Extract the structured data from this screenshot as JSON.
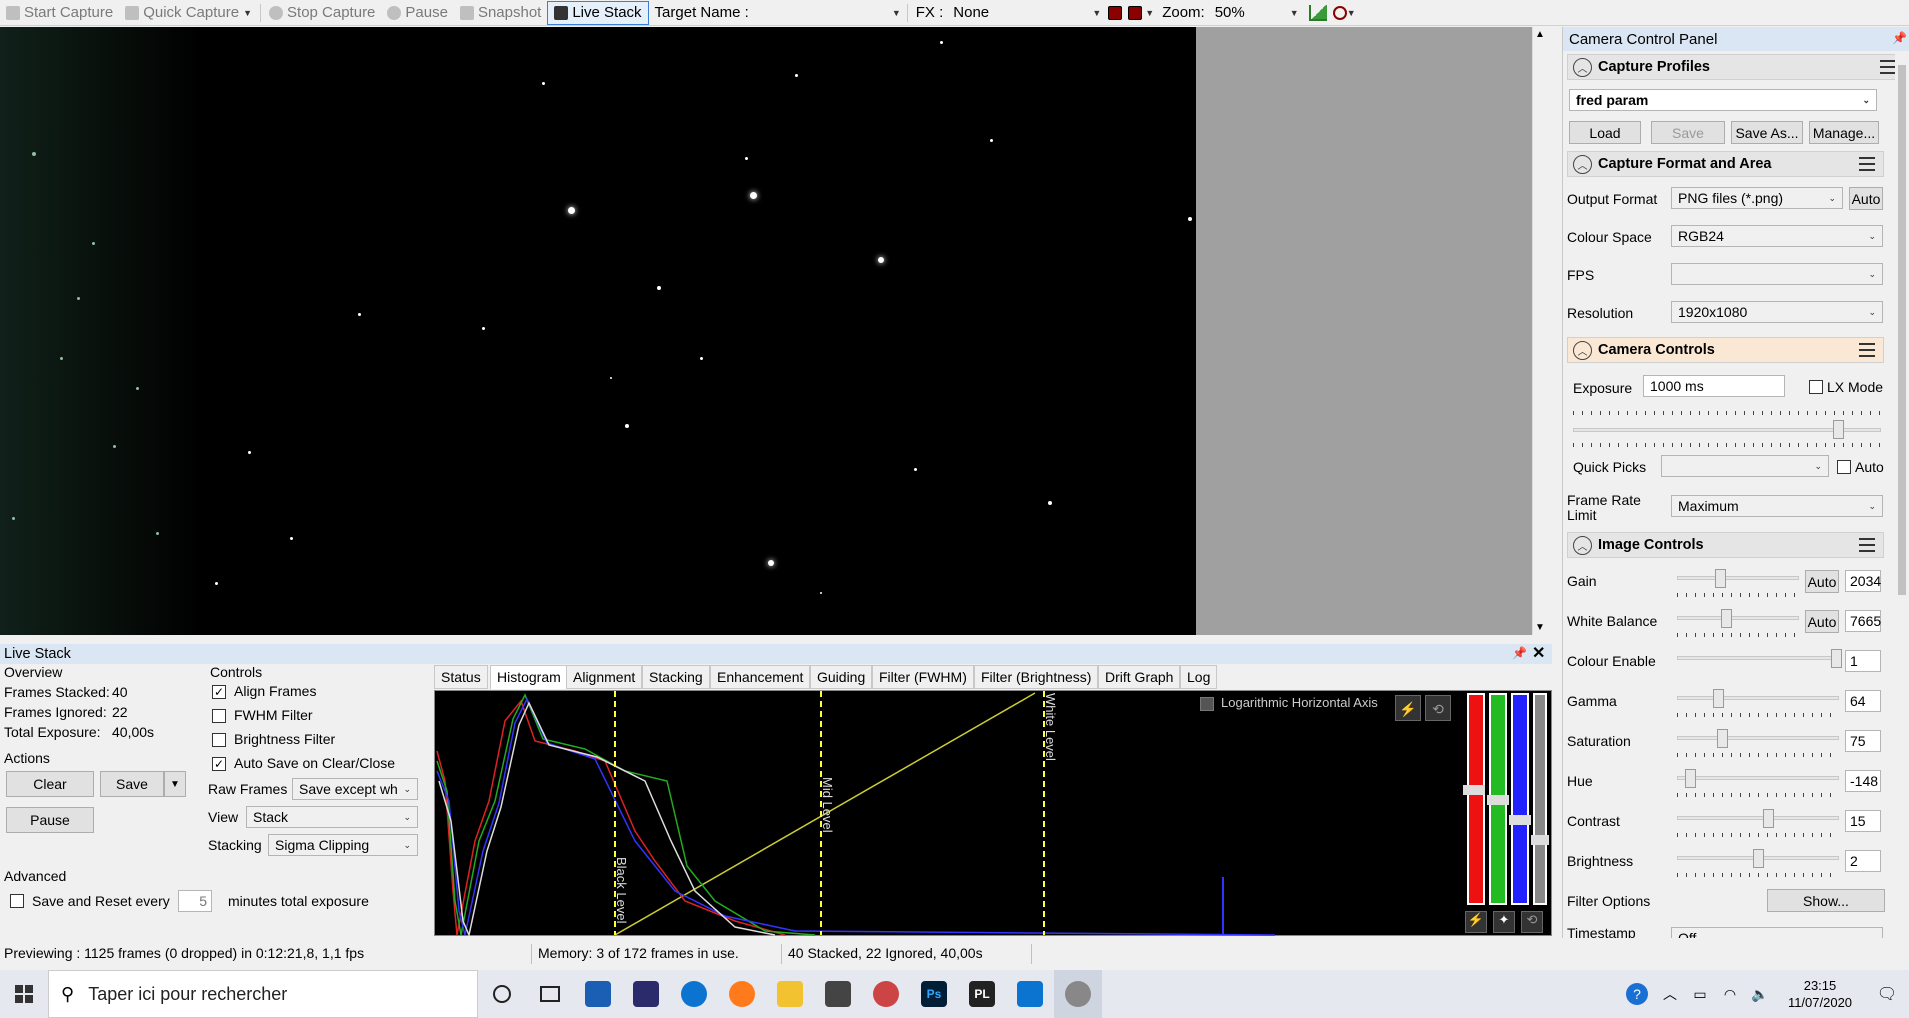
{
  "toolbar": {
    "start_capture": "Start Capture",
    "quick_capture": "Quick Capture",
    "stop_capture": "Stop Capture",
    "pause": "Pause",
    "snapshot": "Snapshot",
    "live_stack": "Live Stack",
    "target_name_label": "Target Name :",
    "target_name_value": "",
    "fx_label": "FX :",
    "fx_value": "None",
    "zoom_label": "Zoom:",
    "zoom_value": "50%"
  },
  "panel": {
    "title": "Camera Control Panel",
    "capture_profiles": {
      "heading": "Capture Profiles",
      "profile": "fred param",
      "load": "Load",
      "save": "Save",
      "save_as": "Save As...",
      "manage": "Manage..."
    },
    "capture_format": {
      "heading": "Capture Format and Area",
      "output_format_label": "Output Format",
      "output_format": "PNG files (*.png)",
      "auto": "Auto",
      "colour_space_label": "Colour Space",
      "colour_space": "RGB24",
      "fps_label": "FPS",
      "fps": "",
      "resolution_label": "Resolution",
      "resolution": "1920x1080"
    },
    "camera_controls": {
      "heading": "Camera Controls",
      "exposure_label": "Exposure",
      "exposure": "1000 ms",
      "lx_mode": "LX Mode",
      "quick_picks_label": "Quick Picks",
      "quick_picks": "",
      "auto": "Auto",
      "frame_rate_label": "Frame Rate Limit",
      "frame_rate": "Maximum"
    },
    "image_controls": {
      "heading": "Image Controls",
      "rows": [
        {
          "label": "Gain",
          "auto": "Auto",
          "value": "2034"
        },
        {
          "label": "White Balance",
          "auto": "Auto",
          "value": "7665"
        },
        {
          "label": "Colour Enable",
          "value": "1"
        },
        {
          "label": "Gamma",
          "value": "64"
        },
        {
          "label": "Saturation",
          "value": "75"
        },
        {
          "label": "Hue",
          "value": "-148"
        },
        {
          "label": "Contrast",
          "value": "15"
        },
        {
          "label": "Brightness",
          "value": "2"
        }
      ],
      "filter_options_label": "Filter Options",
      "show": "Show...",
      "timestamp_label": "Timestamp",
      "timestamp": "Off"
    }
  },
  "livestack": {
    "title": "Live Stack",
    "overview": "Overview",
    "frames_stacked_label": "Frames Stacked:",
    "frames_stacked": "40",
    "frames_ignored_label": "Frames Ignored:",
    "frames_ignored": "22",
    "total_exposure_label": "Total Exposure:",
    "total_exposure": "40,00s",
    "actions": "Actions",
    "clear": "Clear",
    "save": "Save",
    "pause": "Pause",
    "advanced": "Advanced",
    "save_reset_label": "Save and Reset every",
    "save_reset_value": "5",
    "save_reset_suffix": "minutes total exposure",
    "controls": "Controls",
    "align_frames": "Align Frames",
    "fwhm_filter": "FWHM Filter",
    "brightness_filter": "Brightness Filter",
    "auto_save": "Auto Save on Clear/Close",
    "raw_frames_label": "Raw Frames",
    "raw_frames": "Save except wh",
    "view_label": "View",
    "view": "Stack",
    "stacking_label": "Stacking",
    "stacking": "Sigma Clipping",
    "tabs": [
      "Status",
      "Histogram",
      "Alignment",
      "Stacking",
      "Enhancement",
      "Guiding",
      "Filter (FWHM)",
      "Filter (Brightness)",
      "Drift Graph",
      "Log"
    ],
    "histogram": {
      "log_axis": "Logarithmic Horizontal Axis",
      "black_level": "Black Level",
      "mid_level": "Mid Level",
      "white_level": "White Level"
    }
  },
  "status": {
    "previewing": "Previewing : 1125 frames (0 dropped) in 0:12:21,8, 1,1 fps",
    "memory": "Memory: 3 of 172 frames in use.",
    "stacked": "40 Stacked, 22 Ignored, 40,00s"
  },
  "taskbar": {
    "search_placeholder": "Taper ici pour rechercher",
    "time": "23:15",
    "date": "11/07/2020"
  },
  "colors": {
    "accent": "#3b7fd4",
    "panel_title": "#dbe6f4",
    "camera_controls_header": "#fbe8d4",
    "histogram_level": "#ffff33"
  }
}
